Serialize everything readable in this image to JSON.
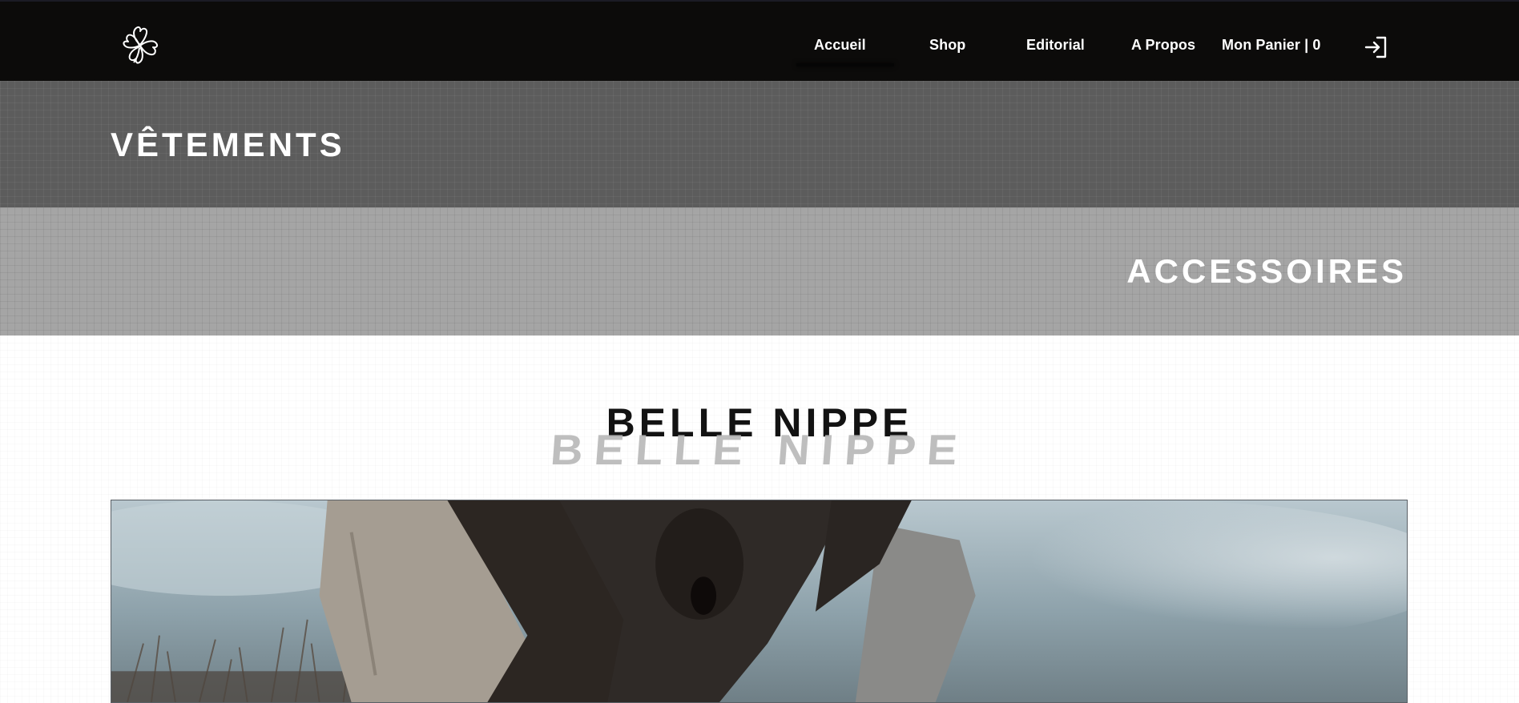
{
  "header": {
    "logo_icon": "clover-flower-icon",
    "nav": {
      "accueil": "Accueil",
      "shop": "Shop",
      "editorial": "Editorial",
      "apropos": "A Propos",
      "cart": "Mon Panier | 0"
    },
    "login_icon": "login-arrow-icon"
  },
  "categories": {
    "vetements": "VÊTEMENTS",
    "accessoires": "ACCESSOIRES"
  },
  "brand": {
    "title": "BELLE NIPPE",
    "echo": "BELLE NIPPE"
  },
  "colors": {
    "nav_bg": "#0c0b0a",
    "band_dark": "#5c5c5c",
    "band_light": "#a5a5a5",
    "text_dark": "#121212"
  }
}
